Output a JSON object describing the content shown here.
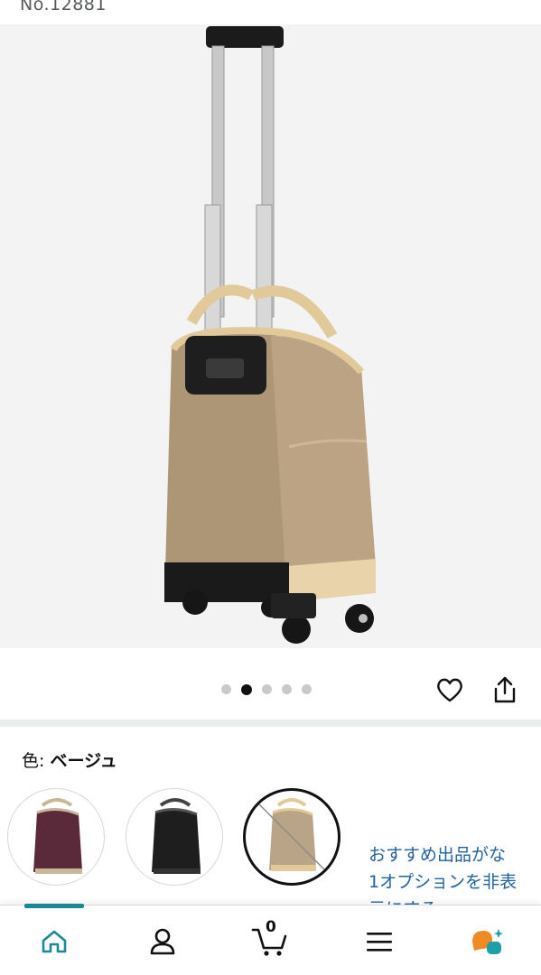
{
  "product": {
    "number_label": "No.12881"
  },
  "carousel": {
    "total_images": 5,
    "active_index": 1
  },
  "variation": {
    "label": "色:",
    "selected_value": "ベージュ",
    "options": [
      {
        "color_name": "purple",
        "color": "#5a2a3a"
      },
      {
        "color_name": "black",
        "color": "#1e1e1e"
      },
      {
        "color_name": "beige",
        "color": "#b9a488",
        "unavailable": true
      }
    ]
  },
  "recommendation": {
    "line1": "おすすめ出品がな",
    "line2": "1オプションを非表",
    "line3": "示にする"
  },
  "nav": {
    "cart_count": "0",
    "items": [
      "home-icon",
      "account-icon",
      "cart-icon",
      "menu-icon",
      "ai-assistant-icon"
    ]
  },
  "colors": {
    "accent": "#1a8a94",
    "link": "#2162a1",
    "ai_orange": "#f08a24",
    "ai_teal": "#1fa0a8"
  }
}
